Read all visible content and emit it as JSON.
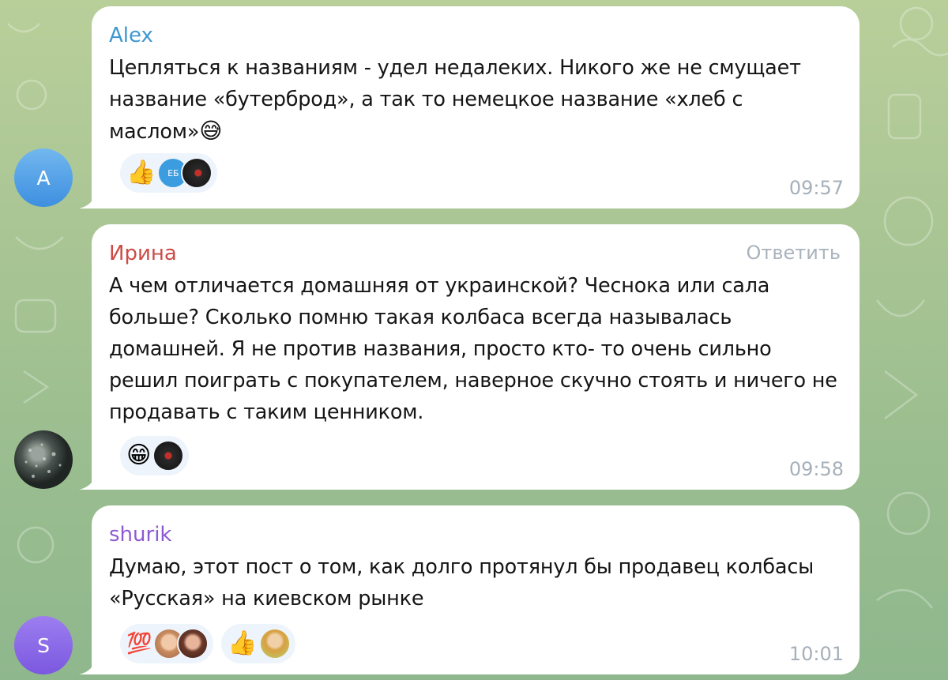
{
  "colors": {
    "background": "#a9c594",
    "alex_name": "#3e97d1",
    "irina_name": "#cc4b46",
    "shurik_name": "#8e5ad2",
    "time": "#a5b0ba",
    "reaction_bg": "#eef4fb"
  },
  "messages": [
    {
      "sender": "Alex",
      "avatar_letter": "A",
      "text": "Цепляться к названиям - удел недалеких. Никого же не смущает название «бутерброд», а так то немецкое название «хлеб с маслом»",
      "inline_emoji": "😅",
      "time": "09:57",
      "reactions": [
        {
          "emoji": "👍",
          "avatars": [
            "ЕБ",
            "dark-avatar"
          ]
        }
      ]
    },
    {
      "sender": "Ирина",
      "reply_label": "Ответить",
      "text": "А чем отличается домашняя от украинской? Чеснока или сала больше? Сколько помню такая колбаса всегда называлась домашней. Я не против названия, просто кто- то очень сильно решил поиграть с покупателем, наверное скучно стоять и ничего не продавать с таким ценником.",
      "time": "09:58",
      "reactions": [
        {
          "emoji": "😁",
          "avatars": [
            "dark-avatar"
          ]
        }
      ]
    },
    {
      "sender": "shurik",
      "avatar_letter": "S",
      "text": "Думаю, этот пост о том, как долго протянул бы продавец колбасы «Русская» на киевском рынке",
      "time": "10:01",
      "reactions": [
        {
          "emoji": "💯",
          "avatars": [
            "photo-avatar-1",
            "photo-avatar-2"
          ]
        },
        {
          "emoji": "👍",
          "avatars": [
            "photo-avatar-3"
          ]
        }
      ]
    }
  ]
}
